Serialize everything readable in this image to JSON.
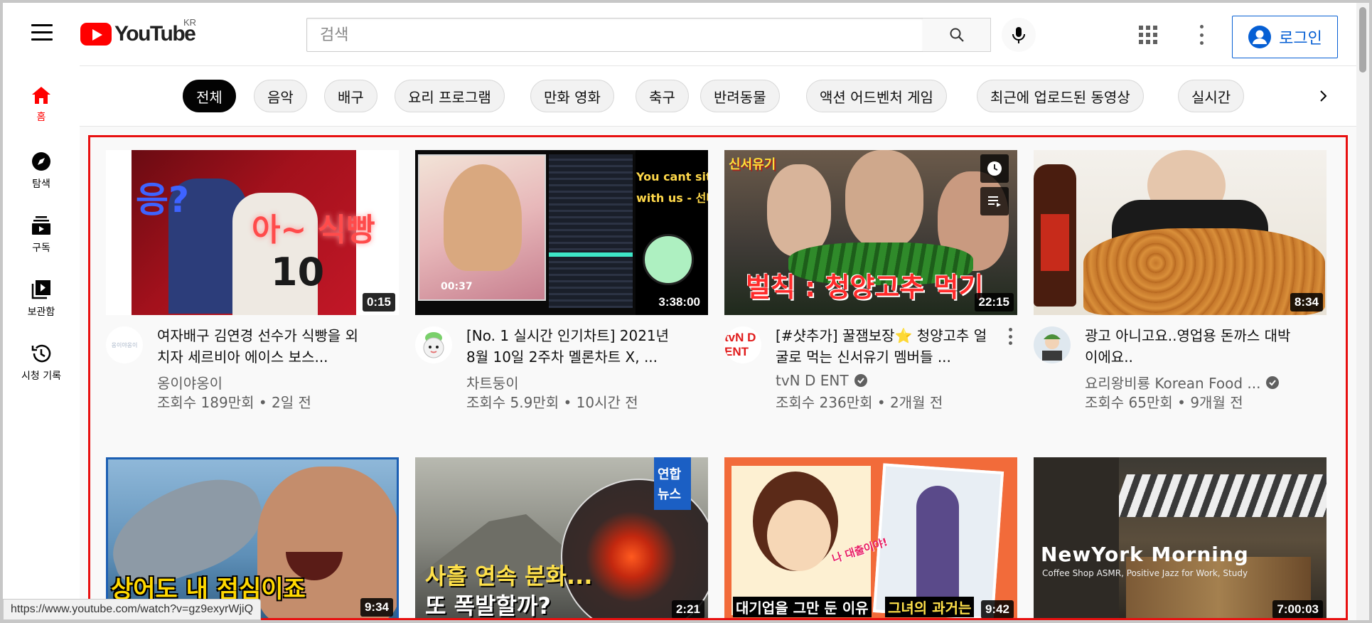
{
  "masthead": {
    "logo_text": "YouTube",
    "region": "KR",
    "search_placeholder": "검색",
    "login_label": "로그인"
  },
  "sidebar": {
    "items": [
      {
        "label": "홈",
        "icon": "home-icon",
        "active": true
      },
      {
        "label": "탐색",
        "icon": "compass-icon"
      },
      {
        "label": "구독",
        "icon": "subscriptions-icon"
      },
      {
        "label": "보관함",
        "icon": "library-icon"
      },
      {
        "label": "시청 기록",
        "icon": "history-icon"
      }
    ]
  },
  "chips": [
    "전체",
    "음악",
    "배구",
    "요리 프로그램",
    "만화 영화",
    "축구",
    "반려동물",
    "액션 어드벤처 게임",
    "최근에 업로드된 동영상",
    "실시간"
  ],
  "videos": [
    {
      "title": "여자배구 김연경 선수가 식빵을 외치자 세르비아 에이스 보스...",
      "channel": "옹이야옹이",
      "stats": "조회수 189만회 • 2일 전",
      "duration": "0:15",
      "verified": false,
      "thumb_texts": [
        "응?",
        "아~ 식빵"
      ]
    },
    {
      "title": "[No. 1 실시간 인기차트] 2021년 8월 10일 2주차 멜론차트 X, ...",
      "channel": "차트둥이",
      "stats": "조회수 5.9만회 • 10시간 전",
      "duration": "3:38:00",
      "verified": false,
      "thumb_texts": [
        "You cant sit",
        "with us - 선미",
        "00:37"
      ]
    },
    {
      "title": "[#샷추가] 꿀잼보장⭐ 청양고추 얼굴로 먹는 신서유기 멤버들 ...",
      "channel": "tvN D ENT",
      "stats": "조회수 236만회 • 2개월 전",
      "duration": "22:15",
      "verified": true,
      "thumb_texts": [
        "벌칙 : 청양고추 먹기",
        "신서유기"
      ]
    },
    {
      "title": "광고 아니고요..영업용 돈까스 대박이에요..",
      "channel": "요리왕비룡 Korean Food ...",
      "stats": "조회수 65만회 • 9개월 전",
      "duration": "8:34",
      "verified": true,
      "thumb_texts": []
    },
    {
      "title": "",
      "channel": "",
      "stats": "",
      "duration": "9:34",
      "verified": false,
      "thumb_texts": [
        "상어도 내 점심이죠"
      ]
    },
    {
      "title": "",
      "channel": "",
      "stats": "",
      "duration": "2:21",
      "verified": false,
      "thumb_texts": [
        "연합",
        "뉴스",
        "사흘 연속 분화...",
        "또 폭발할까?"
      ]
    },
    {
      "title": "",
      "channel": "",
      "stats": "",
      "duration": "9:42",
      "verified": false,
      "thumb_texts": [
        "대기업을 그만 둔 이유",
        "그녀의 과거는",
        "나 대출이야!"
      ]
    },
    {
      "title": "",
      "channel": "",
      "stats": "",
      "duration": "7:00:03",
      "verified": false,
      "thumb_texts": [
        "NewYork Morning",
        "Coffee Shop ASMR, Positive Jazz for Work, Study"
      ]
    }
  ],
  "avatars": [
    "옹이야옹이",
    "tvN D ENT"
  ],
  "status_url": "https://www.youtube.com/watch?v=gz9exyrWjiQ",
  "colors": {
    "brand": "#ff0000",
    "accent": "#065fd4",
    "highlight_border": "#e81010"
  }
}
